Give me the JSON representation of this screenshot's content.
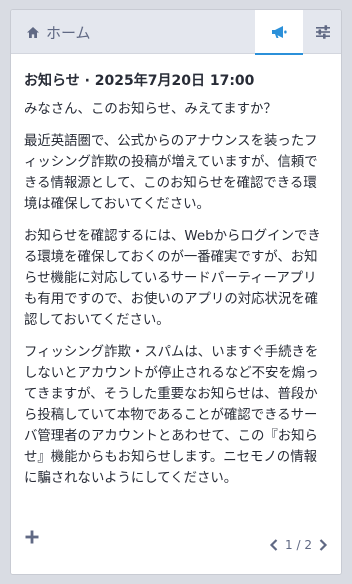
{
  "header": {
    "home_label": "ホーム",
    "tabs": [
      {
        "icon": "megaphone-icon",
        "active": true
      },
      {
        "icon": "sliders-icon",
        "active": false
      }
    ]
  },
  "announcement": {
    "title": "お知らせ · 2025年7月20日 17:00",
    "paragraphs": [
      "みなさん、このお知らせ、みえてますか？",
      "最近英語圏で、公式からのアナウンスを装ったフィッシング詐欺の投稿が増えていますが、信頼できる情報源として、このお知らせを確認できる環境は確保しておいてください。",
      "お知らせを確認するには、Webからログインできる環境を確保しておくのが一番確実ですが、お知らせ機能に対応しているサードパーティーアプリも有用ですので、お使いのアプリの対応状況を確認しておいてください。",
      "フィッシング詐欺・スパムは、いますぐ手続きをしないとアカウントが停止されるなど不安を煽ってきますが、そうした重要なお知らせは、普段から投稿していて本物であることが確認できるサーバ管理者のアカウントとあわせて、この『お知らせ』機能からもお知らせします。ニセモノの情報に騙されないようにしてください。"
    ]
  },
  "pager": {
    "current": "1",
    "separator": "/",
    "total": "2"
  },
  "colors": {
    "accent": "#2b90d9",
    "muted": "#606984",
    "text": "#282c37"
  }
}
